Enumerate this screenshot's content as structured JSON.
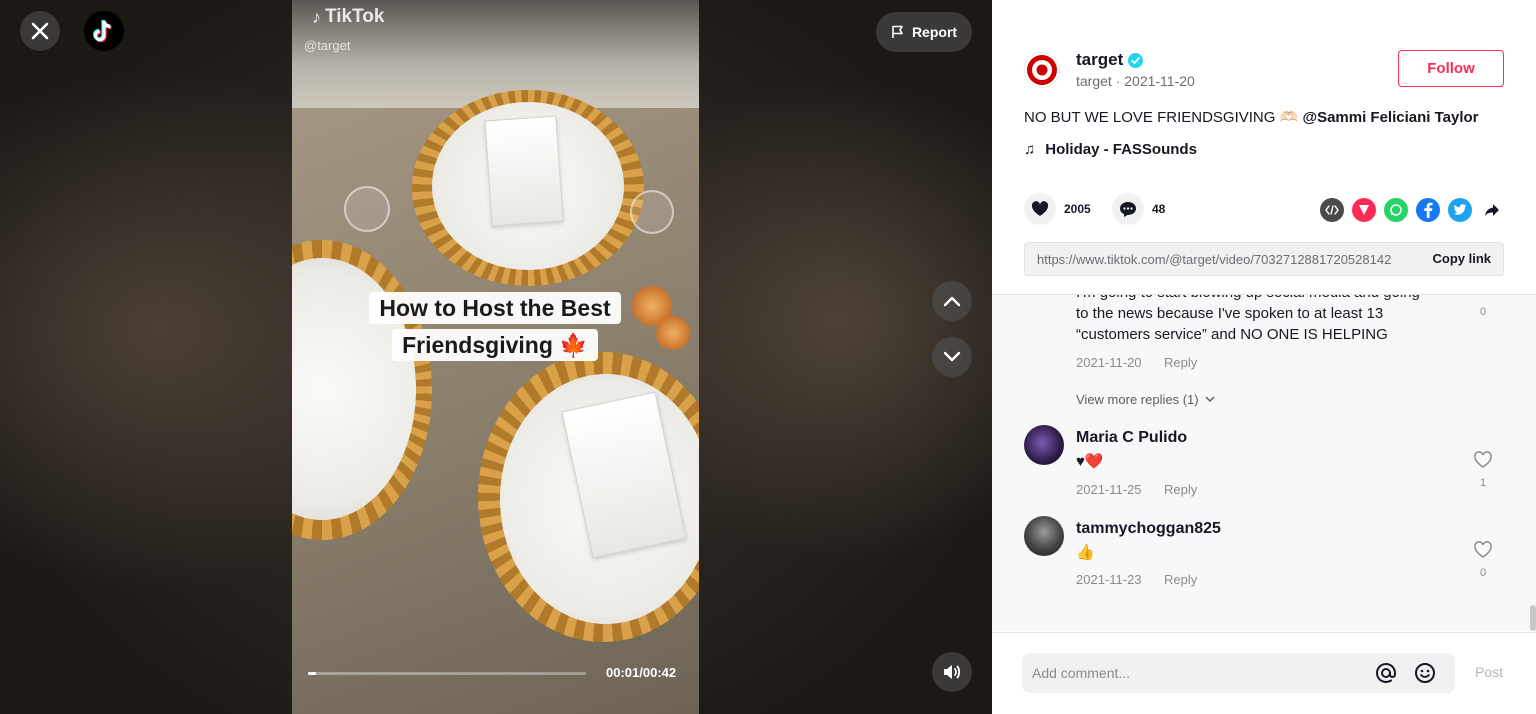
{
  "video": {
    "watermark_brand": "TikTok",
    "watermark_handle": "@target",
    "caption_line1": "How to Host the Best",
    "caption_line2": "Friendsgiving 🍁",
    "report_label": "Report",
    "time": "00:01/00:42",
    "progress_fraction": 0.024
  },
  "post": {
    "author_name": "target",
    "author_sub": "target · 2021-11-20",
    "follow_label": "Follow",
    "description_text": "NO BUT WE LOVE FRIENDSGIVING 🫶🏻 ",
    "description_mention": "@Sammi Feliciani Taylor",
    "music": "Holiday - FASSounds",
    "likes": "2005",
    "comments": "48",
    "link": "https://www.tiktok.com/@target/video/7032712881720528142",
    "copy_label": "Copy link"
  },
  "comments": [
    {
      "text_partial": "I'm going to start blowing up social media and going",
      "text_lines": [
        "to the news because I've spoken to at least 13",
        "“customers service” and NO ONE IS HELPING"
      ],
      "date": "2021-11-20",
      "reply": "Reply",
      "likes": "0"
    },
    {
      "view_more": "View more replies (1)"
    },
    {
      "user": "Maria C Pulido",
      "text": "♥❤️",
      "date": "2021-11-25",
      "reply": "Reply",
      "likes": "1"
    },
    {
      "user": "tammychoggan825",
      "text": "👍",
      "date": "2021-11-23",
      "reply": "Reply",
      "likes": "0"
    }
  ],
  "composer": {
    "placeholder": "Add comment...",
    "post_label": "Post"
  },
  "colors": {
    "brand_red": "#fe2c55",
    "target_red": "#cc0000",
    "verified": "#20d5ec"
  }
}
